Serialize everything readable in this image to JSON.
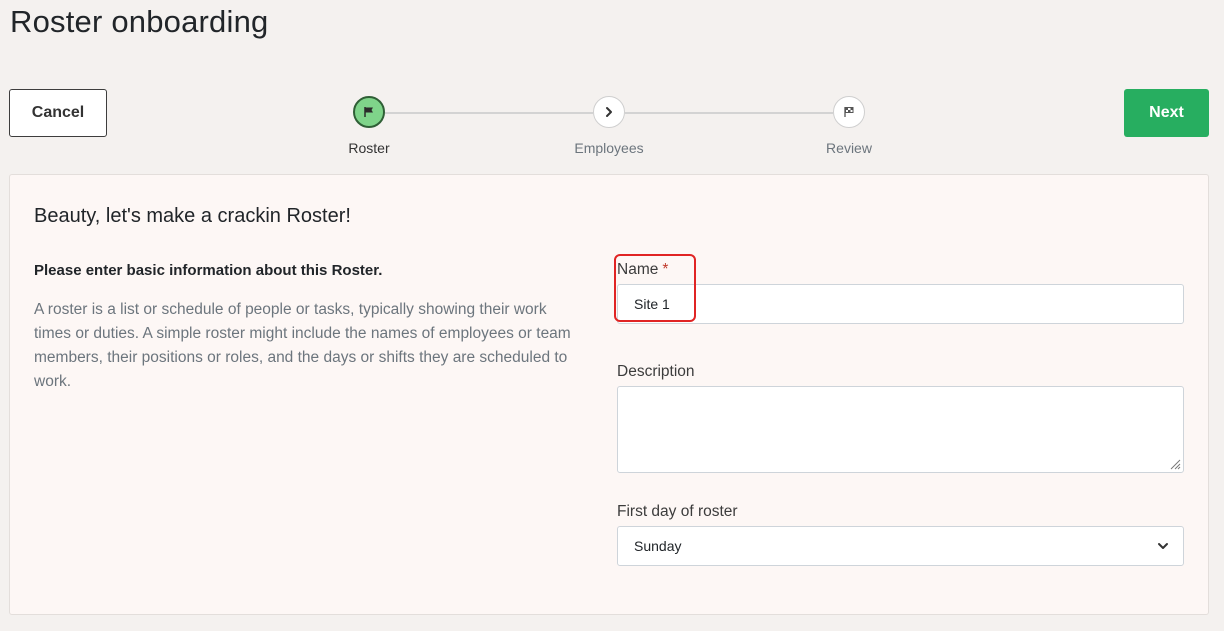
{
  "page": {
    "title": "Roster onboarding"
  },
  "toolbar": {
    "cancel_label": "Cancel",
    "next_label": "Next",
    "next_color": "#27ae60"
  },
  "stepper": {
    "steps": [
      {
        "label": "Roster",
        "icon": "flag-icon",
        "state": "active"
      },
      {
        "label": "Employees",
        "icon": "chevron-right-icon",
        "state": "pending"
      },
      {
        "label": "Review",
        "icon": "checkered-flag-icon",
        "state": "pending"
      }
    ],
    "active_color": "#7fd48a"
  },
  "card": {
    "heading": "Beauty, let's make a crackin Roster!",
    "intro_title": "Please enter basic information about this Roster.",
    "intro_text": "A roster is a list or schedule of people or tasks, typically showing their work times or duties. A simple roster might include the names of employees or team members, their positions or roles, and the days or shifts they are scheduled to work."
  },
  "form": {
    "name": {
      "label": "Name",
      "required_marker": "*",
      "value": "Site 1"
    },
    "description": {
      "label": "Description",
      "value": ""
    },
    "first_day": {
      "label": "First day of roster",
      "selected": "Sunday"
    }
  }
}
